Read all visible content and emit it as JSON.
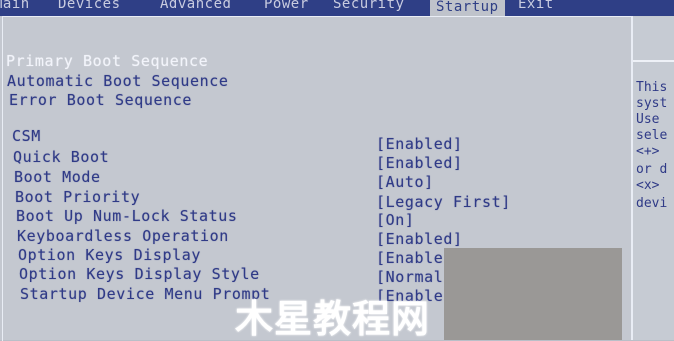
{
  "menu": {
    "tabs": [
      {
        "label": "Main"
      },
      {
        "label": "Devices"
      },
      {
        "label": "Advanced"
      },
      {
        "label": "Power"
      },
      {
        "label": "Security"
      },
      {
        "label": "Startup"
      },
      {
        "label": "Exit"
      }
    ],
    "active_tab": "Startup"
  },
  "sequences": [
    {
      "label": "Primary Boot Sequence"
    },
    {
      "label": "Automatic Boot Sequence"
    },
    {
      "label": "Error Boot Sequence"
    }
  ],
  "settings": [
    {
      "label": "CSM",
      "value": "[Enabled]"
    },
    {
      "label": "Quick Boot",
      "value": "[Enabled]"
    },
    {
      "label": "Boot Mode",
      "value": "[Auto]"
    },
    {
      "label": "Boot Priority",
      "value": "[Legacy First]"
    },
    {
      "label": "Boot Up Num-Lock Status",
      "value": "[On]"
    },
    {
      "label": "Keyboardless Operation",
      "value": "[Enabled]"
    },
    {
      "label": "Option Keys Display",
      "value": "[Enable"
    },
    {
      "label": "Option Keys Display Style",
      "value": "[Normal"
    },
    {
      "label": "Startup Device Menu Prompt",
      "value": "[Enable"
    }
  ],
  "help": {
    "lines": [
      "This",
      "syst",
      "Use",
      "sele",
      "<+>",
      "or d",
      "<x>",
      "devi"
    ]
  },
  "watermark": {
    "text": "木星教程网"
  },
  "colors": {
    "menubar_bg": "#2f3f86",
    "screen_bg": "#c4c8d0",
    "text_blue": "#2f3a87",
    "highlight_text": "#f2f4fb"
  }
}
